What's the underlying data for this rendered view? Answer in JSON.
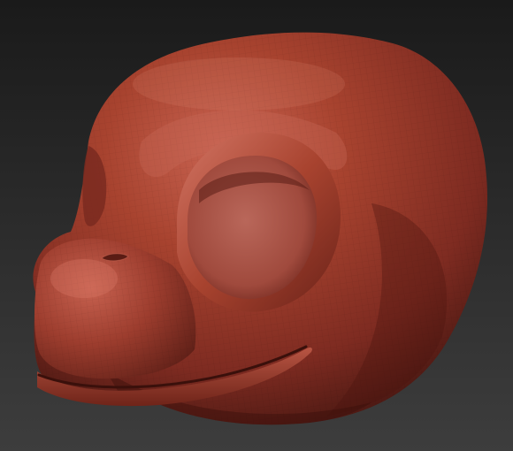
{
  "colors": {
    "background_top": "#1a1a1a",
    "background_bottom": "#3d3d3d",
    "clay_highlight": "#c05a48",
    "clay_base": "#9a3a2c",
    "clay_shadow": "#5c1f18",
    "clay_deep_shadow": "#3a120e"
  },
  "scene": {
    "subject": "sculpted-creature-head",
    "material": "red-clay-matcap",
    "wireframe_overlay": true
  }
}
